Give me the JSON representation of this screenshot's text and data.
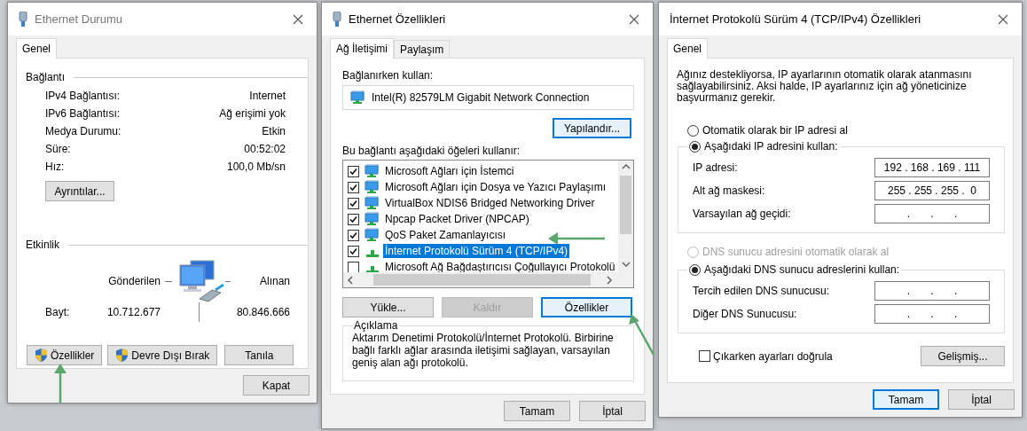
{
  "status_window": {
    "title": "Ethernet Durumu",
    "tabs": [
      {
        "label": "Genel",
        "selected": true
      }
    ],
    "connection": {
      "heading": "Bağlantı",
      "rows": [
        {
          "label": "IPv4 Bağlantısı:",
          "value": "Internet"
        },
        {
          "label": "IPv6 Bağlantısı:",
          "value": "Ağ erişimi yok"
        },
        {
          "label": "Medya Durumu:",
          "value": "Etkin"
        },
        {
          "label": "Süre:",
          "value": "00:52:02"
        },
        {
          "label": "Hız:",
          "value": "100,0 Mb/sn"
        }
      ],
      "details_button": "Ayrıntılar..."
    },
    "activity": {
      "heading": "Etkinlik",
      "sent_label": "Gönderilen",
      "received_label": "Alınan",
      "bytes_label": "Bayt:",
      "sent": "10.712.677",
      "received": "80.846.666"
    },
    "buttons": [
      {
        "label": "Özellikler",
        "shield": true
      },
      {
        "label": "Devre Dışı Bırak",
        "shield": true
      },
      {
        "label": "Tanıla",
        "shield": false
      }
    ],
    "close_button": "Kapat"
  },
  "properties_window": {
    "title": "Ethernet Özellikleri",
    "tabs": [
      {
        "label": "Ağ İletişimi",
        "selected": true
      },
      {
        "label": "Paylaşım",
        "selected": false
      }
    ],
    "connect_using_label": "Bağlanırken kullan:",
    "adapter": "Intel(R) 82579LM Gigabit Network Connection",
    "configure_button": "Yapılandır...",
    "items_label": "Bu bağlantı aşağıdaki öğeleri kullanır:",
    "items": [
      {
        "label": "Microsoft Ağları için İstemci",
        "kind": "service",
        "checked": true,
        "selected": false
      },
      {
        "label": "Microsoft Ağları için Dosya ve Yazıcı Paylaşımı",
        "kind": "service",
        "checked": true,
        "selected": false
      },
      {
        "label": "VirtualBox NDIS6 Bridged Networking Driver",
        "kind": "service",
        "checked": true,
        "selected": false
      },
      {
        "label": "Npcap Packet Driver (NPCAP)",
        "kind": "service",
        "checked": true,
        "selected": false
      },
      {
        "label": "QoS Paket Zamanlayıcısı",
        "kind": "service",
        "checked": true,
        "selected": false
      },
      {
        "label": "İnternet Protokolü Sürüm 4 (TCP/IPv4)",
        "kind": "protocol",
        "checked": true,
        "selected": true
      },
      {
        "label": "Microsoft Ağ Bağdaştırıcısı Çoğullayıcı Protokolü",
        "kind": "protocol",
        "checked": false,
        "selected": false
      }
    ],
    "buttons": [
      {
        "label": "Yükle...",
        "disabled": false,
        "focused": false
      },
      {
        "label": "Kaldır",
        "disabled": true,
        "focused": false
      },
      {
        "label": "Özellikler",
        "disabled": false,
        "focused": true
      }
    ],
    "description": {
      "heading": "Açıklama",
      "text": "Aktarım Denetimi Protokolü/İnternet Protokolü. Birbirine bağlı farklı ağlar arasında iletişimi sağlayan, varsayılan geniş alan ağı protokolü."
    },
    "footer_buttons": [
      {
        "label": "Tamam",
        "focused": false
      },
      {
        "label": "İptal",
        "focused": false
      }
    ]
  },
  "ipv4_window": {
    "title": "İnternet Protokolü Sürüm 4 (TCP/IPv4) Özellikleri",
    "tabs": [
      {
        "label": "Genel",
        "selected": true
      }
    ],
    "intro": "Ağınız destekliyorsa, IP ayarlarının otomatik olarak atanmasını sağlayabilirsiniz. Aksi halde, IP ayarlarınız için ağ yöneticinize başvurmanız gerekir.",
    "ip_options": [
      {
        "label": "Otomatik olarak bir IP adresi al",
        "selected": false,
        "disabled": false
      },
      {
        "label": "Aşağıdaki IP adresini kullan:",
        "selected": true,
        "disabled": false
      }
    ],
    "ip_fields": [
      {
        "label": "IP adresi:",
        "value": "192 . 168 . 169 . 111"
      },
      {
        "label": "Alt ağ maskesi:",
        "value": "255 . 255 . 255 .  0"
      },
      {
        "label": "Varsayılan ağ geçidi:",
        "value": ".       .       ."
      }
    ],
    "dns_options": [
      {
        "label": "DNS sunucu adresini otomatik olarak al",
        "selected": false,
        "disabled": true
      },
      {
        "label": "Aşağıdaki DNS sunucu adreslerini kullan:",
        "selected": true,
        "disabled": false
      }
    ],
    "dns_fields": [
      {
        "label": "Tercih edilen DNS sunucusu:",
        "value": ".       .       ."
      },
      {
        "label": "Diğer DNS Sunucusu:",
        "value": ".       .       ."
      }
    ],
    "validate_checkbox": {
      "label": "Çıkarken ayarları doğrula",
      "checked": false
    },
    "advanced_button": "Gelişmiş...",
    "footer_buttons": [
      {
        "label": "Tamam",
        "focused": true
      },
      {
        "label": "İptal",
        "focused": false
      }
    ]
  }
}
